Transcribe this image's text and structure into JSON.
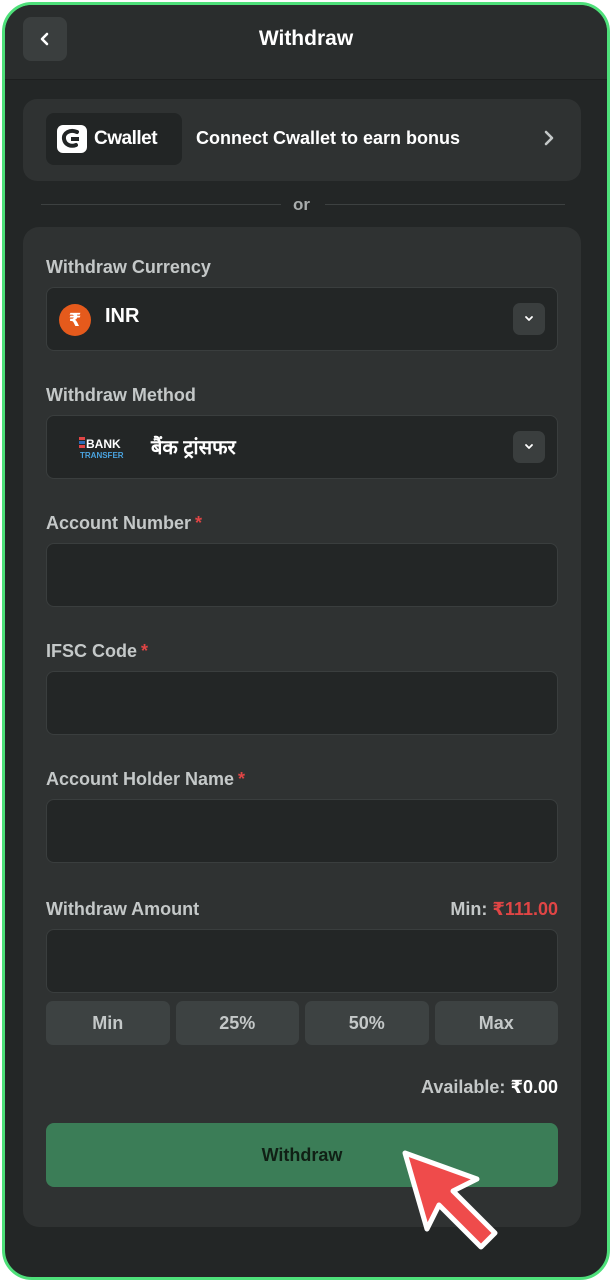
{
  "header": {
    "title": "Withdraw",
    "back_icon": "chevron-left-icon"
  },
  "cwallet": {
    "logo_text": "Cwallet",
    "text": "Connect Cwallet to earn bonus",
    "chevron_icon": "chevron-right-icon"
  },
  "divider": {
    "text": "or"
  },
  "form": {
    "currency": {
      "label": "Withdraw Currency",
      "value": "INR",
      "icon": "rupee-icon",
      "symbol": "₹"
    },
    "method": {
      "label": "Withdraw Method",
      "value": "बैंक ट्रांसफर",
      "logo_line1": "BANK",
      "logo_line2": "TRANSFER"
    },
    "account_number": {
      "label": "Account Number",
      "required": "*",
      "value": ""
    },
    "ifsc": {
      "label": "IFSC Code",
      "required": "*",
      "value": ""
    },
    "holder_name": {
      "label": "Account Holder Name",
      "required": "*",
      "value": ""
    },
    "amount": {
      "label": "Withdraw Amount",
      "min_prefix": "Min:",
      "min_value": "₹111.00",
      "value": "",
      "buttons": [
        "Min",
        "25%",
        "50%",
        "Max"
      ]
    },
    "available": {
      "label": "Available:",
      "value": "₹0.00"
    },
    "submit_label": "Withdraw"
  },
  "colors": {
    "frame_border": "#4ee07a",
    "accent_button": "#3b7d57",
    "required": "#e04545",
    "inr_badge": "#e55a1c",
    "cursor": "#ef4b4b"
  }
}
